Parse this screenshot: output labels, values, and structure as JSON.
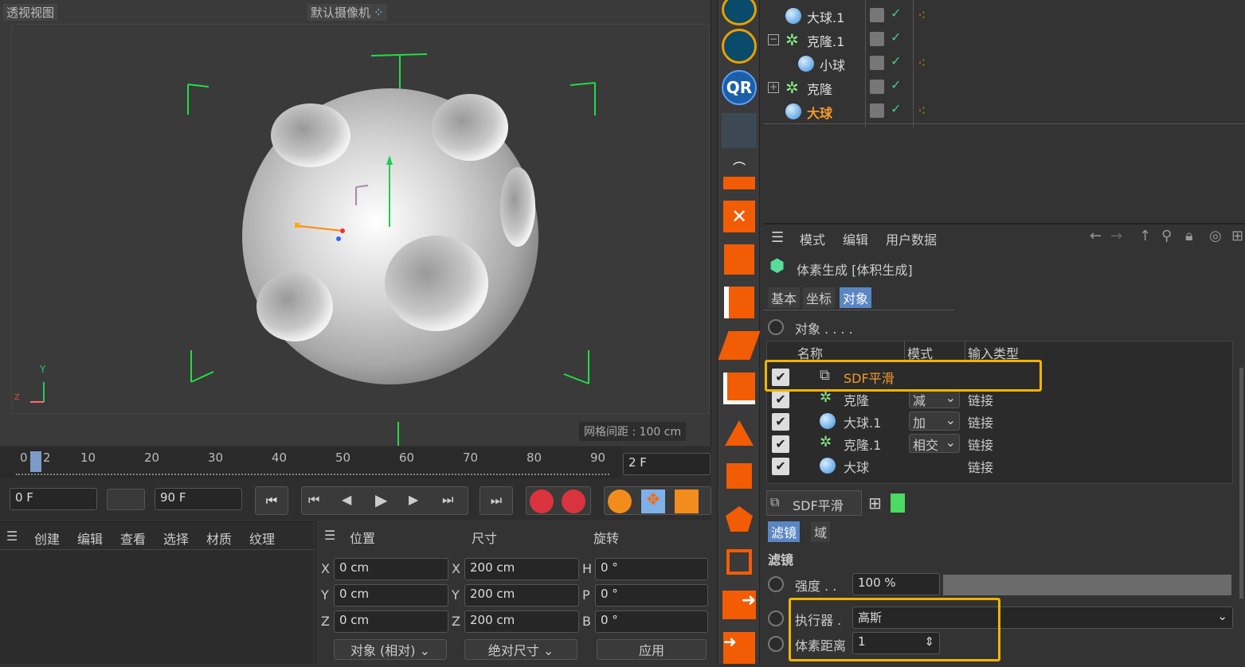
{
  "viewport": {
    "title": "透视视图",
    "camera": "默认摄像机",
    "grid_spacing": "网格间距 : 100 cm"
  },
  "timeline": {
    "ticks": [
      "0",
      "2",
      "10",
      "20",
      "30",
      "40",
      "50",
      "60",
      "70",
      "80",
      "90"
    ],
    "current_frame": "2 F",
    "start": "0 F",
    "end": "90 F"
  },
  "menu_bl": {
    "items": [
      "创建",
      "编辑",
      "查看",
      "选择",
      "材质",
      "纹理"
    ]
  },
  "coords": {
    "headers": [
      "位置",
      "尺寸",
      "旋转"
    ],
    "pos": {
      "x": "0 cm",
      "y": "0 cm",
      "z": "0 cm"
    },
    "size": {
      "x": "200 cm",
      "y": "200 cm",
      "z": "200 cm"
    },
    "rot": {
      "h": "0 °",
      "p": "0 °",
      "b": "0 °"
    },
    "axis_labels": {
      "x": "X",
      "y": "Y",
      "z": "Z",
      "h": "H",
      "p": "P",
      "b": "B"
    },
    "mode": "对象 (相对)",
    "size_mode": "绝对尺寸",
    "apply": "应用"
  },
  "objects": [
    {
      "name": "大球.1",
      "type": "sphere",
      "indent": 1,
      "selected": false
    },
    {
      "name": "克隆.1",
      "type": "cloner",
      "indent": 0,
      "selected": false
    },
    {
      "name": "小球",
      "type": "sphere",
      "indent": 2,
      "selected": false
    },
    {
      "name": "克隆",
      "type": "cloner",
      "indent": 0,
      "selected": false
    },
    {
      "name": "大球",
      "type": "sphere",
      "indent": 1,
      "selected": true
    }
  ],
  "attr": {
    "menu": [
      "模式",
      "编辑",
      "用户数据"
    ],
    "object_title": "体素生成 [体积生成]",
    "tabs": [
      "基本",
      "坐标",
      "对象"
    ],
    "section": "对象 . . . .",
    "table_headers": [
      "名称",
      "模式",
      "输入类型"
    ],
    "rows": [
      {
        "name": "SDF平滑",
        "mode": "",
        "input": "",
        "highlight": true
      },
      {
        "name": "克隆",
        "mode": "减",
        "input": "链接"
      },
      {
        "name": "大球.1",
        "mode": "加",
        "input": "链接"
      },
      {
        "name": "克隆.1",
        "mode": "相交",
        "input": "链接"
      },
      {
        "name": "大球",
        "mode": "",
        "input": "链接"
      }
    ],
    "sub_title": "SDF平滑",
    "sub_tabs": [
      "滤镜",
      "域"
    ],
    "filter_heading": "滤镜",
    "strength_label": "强度 . .",
    "strength_value": "100 %",
    "executor_label": "执行器 .",
    "executor_value": "高斯",
    "voxel_label": "体素距离",
    "voxel_value": "1"
  },
  "colors": {
    "accent": "#f0b400",
    "selected_text": "#f39a2b",
    "tab_active": "#5a86c4",
    "grid_green": "#22dd44"
  }
}
